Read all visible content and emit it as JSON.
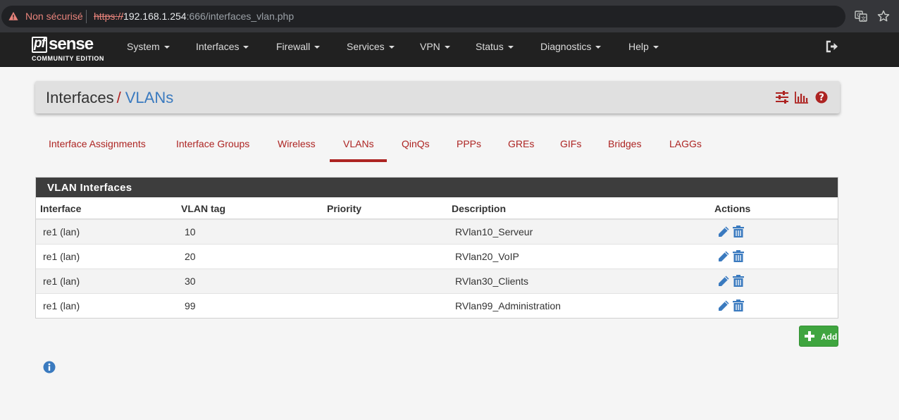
{
  "browser": {
    "security_label": "Non sécurisé",
    "url_scheme": "https://",
    "url_host": "192.168.1.254",
    "url_path": ":666/interfaces_vlan.php"
  },
  "navbar": {
    "logo_pf": "pf",
    "logo_sense": "sense",
    "logo_edition": "COMMUNITY EDITION",
    "menu": [
      "System",
      "Interfaces",
      "Firewall",
      "Services",
      "VPN",
      "Status",
      "Diagnostics",
      "Help"
    ]
  },
  "breadcrumb": {
    "parent": "Interfaces",
    "separator": "/",
    "current": "VLANs"
  },
  "tabs": [
    "Interface Assignments",
    "Interface Groups",
    "Wireless",
    "VLANs",
    "QinQs",
    "PPPs",
    "GREs",
    "GIFs",
    "Bridges",
    "LAGGs"
  ],
  "active_tab": "VLANs",
  "panel": {
    "title": "VLAN Interfaces",
    "columns": [
      "Interface",
      "VLAN tag",
      "Priority",
      "Description",
      "Actions"
    ],
    "rows": [
      {
        "interface": "re1 (lan)",
        "tag": "10",
        "priority": "",
        "description": "RVlan10_Serveur"
      },
      {
        "interface": "re1 (lan)",
        "tag": "20",
        "priority": "",
        "description": "RVlan20_VoIP"
      },
      {
        "interface": "re1 (lan)",
        "tag": "30",
        "priority": "",
        "description": "RVlan30_Clients"
      },
      {
        "interface": "re1 (lan)",
        "tag": "99",
        "priority": "",
        "description": "RVlan99_Administration"
      }
    ]
  },
  "add_button": {
    "label": "Add"
  },
  "colors": {
    "accent_red": "#ad2422",
    "link_blue": "#3a7abf",
    "success_green": "#3fa53f",
    "navbar_bg": "#212121"
  },
  "icons": {
    "warning": "warning-icon",
    "translate": "translate-icon",
    "bookmark": "star-icon",
    "logout": "logout-icon",
    "settings": "sliders-icon",
    "chart": "bar-chart-icon",
    "help": "help-icon",
    "edit": "pencil-icon",
    "delete": "trash-icon",
    "add": "plus-icon",
    "info": "info-icon"
  }
}
